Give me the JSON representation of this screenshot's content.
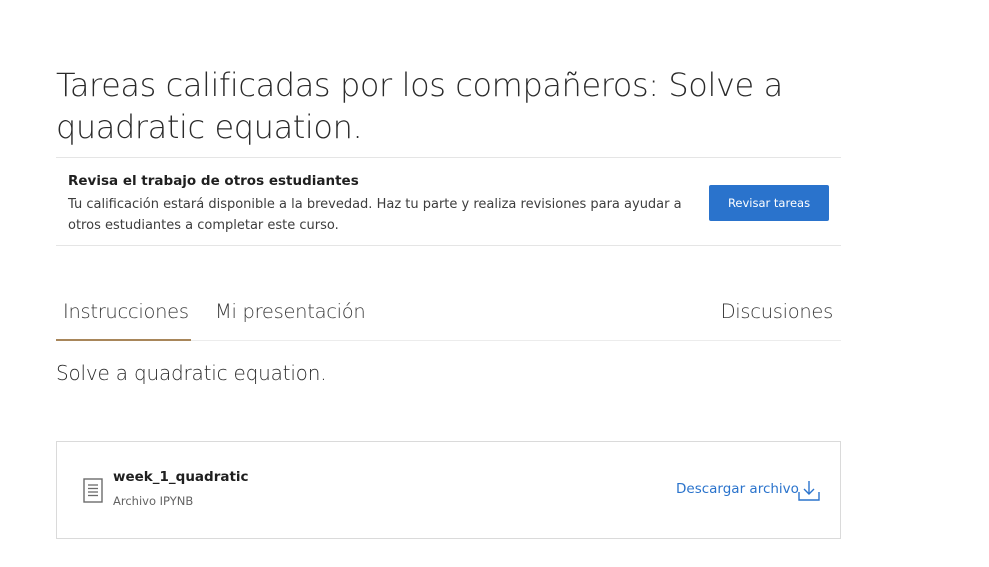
{
  "page": {
    "title": "Tareas calificadas por los compañeros: Solve a quadratic equation."
  },
  "review": {
    "heading": "Revisa el trabajo de otros estudiantes",
    "text": "Tu calificación estará disponible a la brevedad. Haz tu parte y realiza revisiones para ayudar a otros estudiantes a completar este curso.",
    "button_label": "Revisar tareas"
  },
  "tabs": {
    "items": [
      {
        "label": "Instrucciones",
        "active": true
      },
      {
        "label": "Mi presentación",
        "active": false
      },
      {
        "label": "Discusiones",
        "active": false
      }
    ]
  },
  "instructions": {
    "text": "Solve a quadratic equation."
  },
  "attachment": {
    "name": "week_1_quadratic",
    "type": "Archivo IPYNB",
    "download_label": "Descargar archivo",
    "icon": "document-icon",
    "download_icon": "download-icon"
  },
  "colors": {
    "accent": "#2a73cc",
    "tab_underline": "#a8865a",
    "border": "#dadada"
  }
}
